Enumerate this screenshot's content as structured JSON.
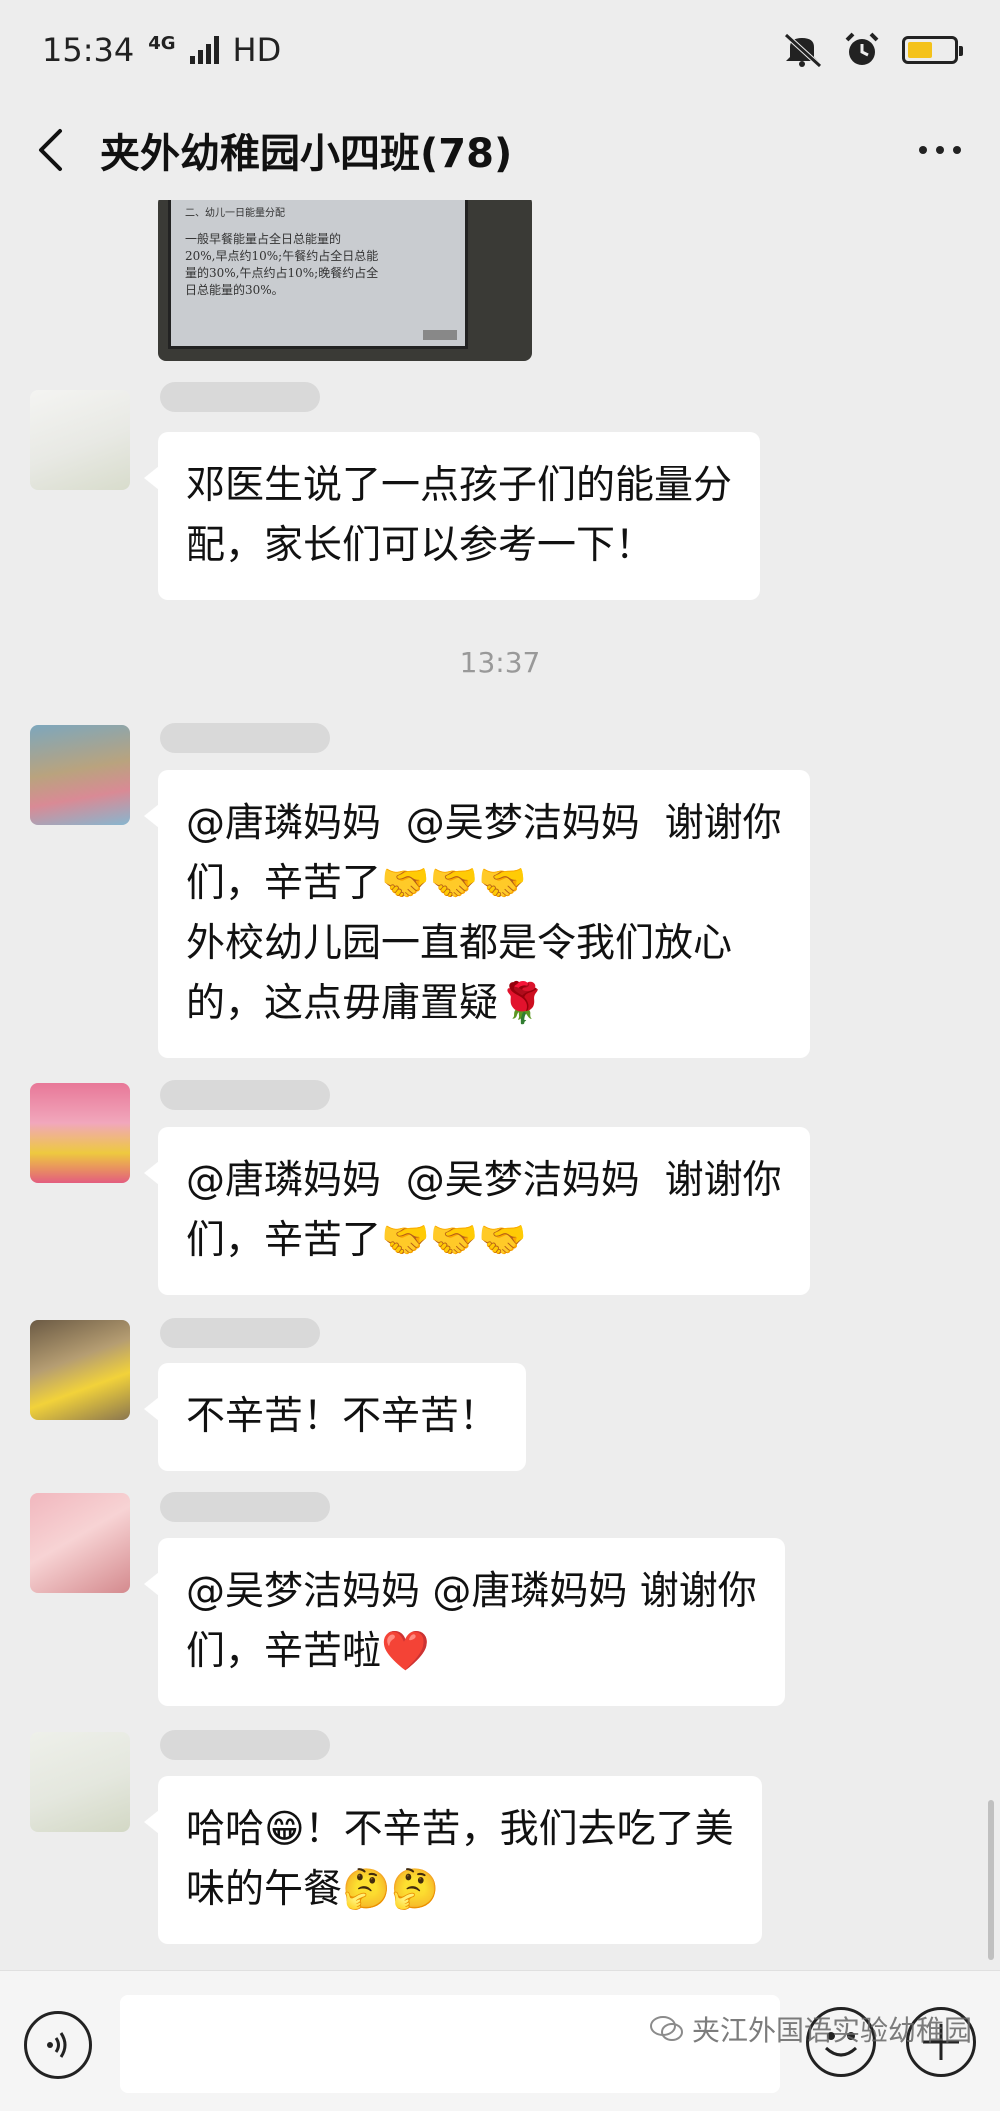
{
  "status": {
    "time": "15:34",
    "network": "4G",
    "hd": "HD",
    "battery_level": 0.55
  },
  "header": {
    "title": "夹外幼稚园小四班(78)"
  },
  "chat": {
    "slide": {
      "heading": "二、幼儿一日能量分配",
      "body": [
        "一般早餐能量占全日总能量的",
        "20%,早点约10%;午餐约占全日总能",
        "量的30%,午点约占10%;晚餐约占全",
        "日总能量的30%。"
      ]
    },
    "messages": [
      {
        "lines": [
          "邓医生说了一点孩子们的能量分",
          "配，家长们可以参考一下！"
        ]
      },
      {
        "lines": [
          "@唐璘妈妈  @吴梦洁妈妈  谢谢你",
          "们，辛苦了🤝🤝🤝",
          "外校幼儿园一直都是令我们放心",
          "的，这点毋庸置疑🌹"
        ]
      },
      {
        "lines": [
          "@唐璘妈妈  @吴梦洁妈妈  谢谢你",
          "们，辛苦了🤝🤝🤝"
        ]
      },
      {
        "lines": [
          "不辛苦！不辛苦！"
        ]
      },
      {
        "lines": [
          "@吴梦洁妈妈 @唐璘妈妈 谢谢你",
          "们，辛苦啦❤️"
        ]
      },
      {
        "lines": [
          "哈哈😁！不辛苦，我们去吃了美",
          "味的午餐🤔🤔"
        ]
      }
    ],
    "timestamp": "13:37"
  },
  "footer": {
    "watermark": "夹江外国语实验幼稚园"
  },
  "colors": {
    "background": "#ededed",
    "bubble": "#ffffff",
    "battery": "#f4c21a"
  },
  "icons": [
    "signal-icon",
    "mute-icon",
    "alarm-icon",
    "battery-icon",
    "back-arrow-icon",
    "more-icon",
    "voice-icon",
    "emoji-icon",
    "plus-icon",
    "wechat-logo-icon"
  ]
}
